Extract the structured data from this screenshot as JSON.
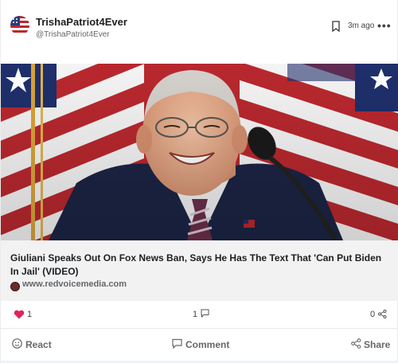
{
  "post": {
    "author_name": "TrishaPatriot4Ever",
    "author_handle": "@TrishaPatriot4Ever",
    "timestamp": "3m ago",
    "more_label": "•••",
    "icons": {
      "avatar": "flag-avatar",
      "bookmark": "bookmark-icon",
      "more": "more-options-icon"
    }
  },
  "media": {
    "description_icon": "photo-of-speaker-at-podium-with-flags"
  },
  "preview": {
    "title": "Giuliani Speaks Out On Fox News Ban, Says He Has The Text That 'Can Put Biden In Jail' (VIDEO)",
    "domain": "www.redvoicemedia.com"
  },
  "stats": {
    "reactions": "1",
    "comments": "1",
    "shares": "0"
  },
  "actions": {
    "react": "React",
    "comment": "Comment",
    "share": "Share"
  },
  "colors": {
    "heart": "#e0245e",
    "flag_red": "#b8282e",
    "flag_blue": "#1f2f6b",
    "preview_bg": "#f2f2f2"
  }
}
